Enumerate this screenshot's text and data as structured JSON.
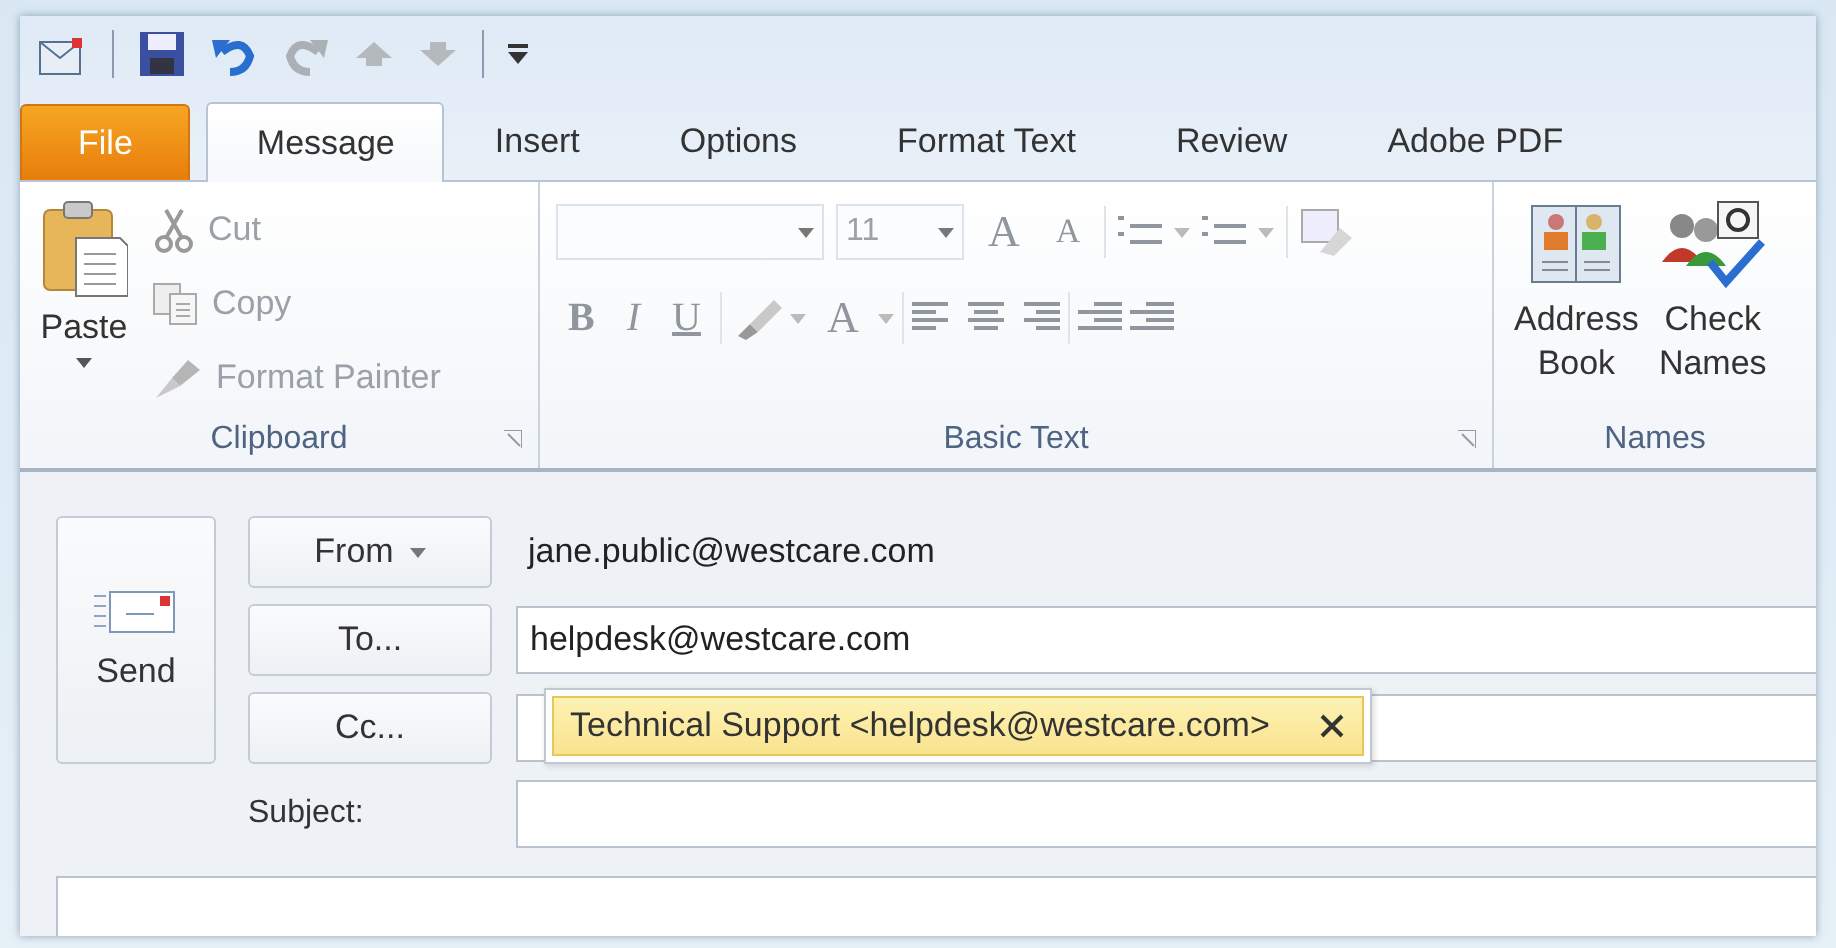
{
  "tabs": [
    {
      "label": "File",
      "kind": "file",
      "selected": false
    },
    {
      "label": "Message",
      "kind": "tab",
      "selected": true
    },
    {
      "label": "Insert",
      "kind": "tab",
      "selected": false
    },
    {
      "label": "Options",
      "kind": "tab",
      "selected": false
    },
    {
      "label": "Format Text",
      "kind": "tab",
      "selected": false
    },
    {
      "label": "Review",
      "kind": "tab",
      "selected": false
    },
    {
      "label": "Adobe PDF",
      "kind": "tab",
      "selected": false
    }
  ],
  "clipboard": {
    "label": "Clipboard",
    "paste": "Paste",
    "items": [
      {
        "label": "Cut",
        "kind": "cut",
        "disabled": true
      },
      {
        "label": "Copy",
        "kind": "copy",
        "disabled": true
      },
      {
        "label": "Format Painter",
        "kind": "painter",
        "disabled": true
      }
    ]
  },
  "basic_text": {
    "label": "Basic Text",
    "font_size": "11",
    "grow_font": "A",
    "shrink_font": "A",
    "font_color": "A",
    "format_buttons": [
      {
        "label": "B",
        "kind": "bold"
      },
      {
        "label": "I",
        "kind": "italic"
      },
      {
        "label": "U",
        "kind": "underline"
      }
    ]
  },
  "names": {
    "label": "Names",
    "buttons": [
      {
        "label": "Address Book",
        "kind": "book"
      },
      {
        "label": "Check Names",
        "kind": "check"
      }
    ]
  },
  "compose": {
    "send": "Send",
    "from_button": "From",
    "from_value": "jane.public@westcare.com",
    "to_button": "To...",
    "to_value": "helpdesk@westcare.com",
    "cc_button": "Cc...",
    "subject_label": "Subject:",
    "suggestion": "Technical Support <helpdesk@westcare.com>"
  }
}
